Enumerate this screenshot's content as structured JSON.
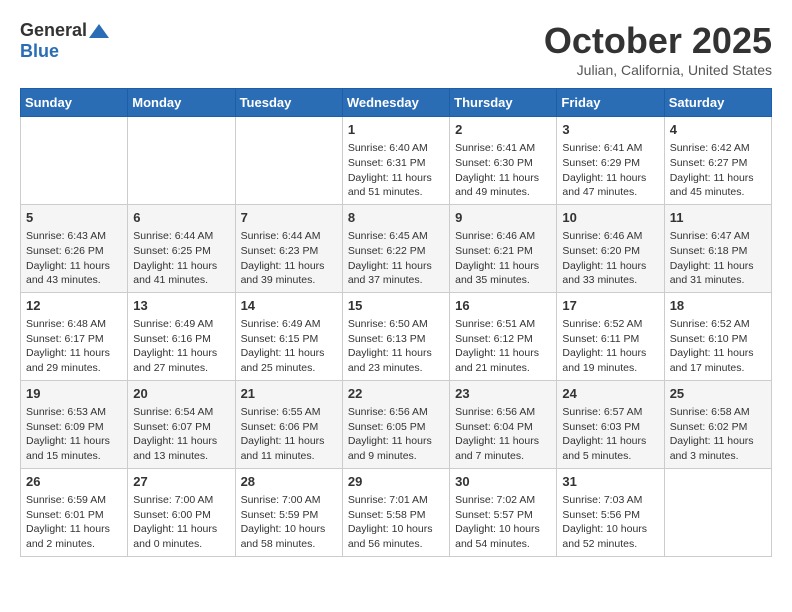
{
  "header": {
    "logo_general": "General",
    "logo_blue": "Blue",
    "month": "October 2025",
    "location": "Julian, California, United States"
  },
  "weekdays": [
    "Sunday",
    "Monday",
    "Tuesday",
    "Wednesday",
    "Thursday",
    "Friday",
    "Saturday"
  ],
  "weeks": [
    [
      {
        "day": "",
        "info": ""
      },
      {
        "day": "",
        "info": ""
      },
      {
        "day": "",
        "info": ""
      },
      {
        "day": "1",
        "info": "Sunrise: 6:40 AM\nSunset: 6:31 PM\nDaylight: 11 hours and 51 minutes."
      },
      {
        "day": "2",
        "info": "Sunrise: 6:41 AM\nSunset: 6:30 PM\nDaylight: 11 hours and 49 minutes."
      },
      {
        "day": "3",
        "info": "Sunrise: 6:41 AM\nSunset: 6:29 PM\nDaylight: 11 hours and 47 minutes."
      },
      {
        "day": "4",
        "info": "Sunrise: 6:42 AM\nSunset: 6:27 PM\nDaylight: 11 hours and 45 minutes."
      }
    ],
    [
      {
        "day": "5",
        "info": "Sunrise: 6:43 AM\nSunset: 6:26 PM\nDaylight: 11 hours and 43 minutes."
      },
      {
        "day": "6",
        "info": "Sunrise: 6:44 AM\nSunset: 6:25 PM\nDaylight: 11 hours and 41 minutes."
      },
      {
        "day": "7",
        "info": "Sunrise: 6:44 AM\nSunset: 6:23 PM\nDaylight: 11 hours and 39 minutes."
      },
      {
        "day": "8",
        "info": "Sunrise: 6:45 AM\nSunset: 6:22 PM\nDaylight: 11 hours and 37 minutes."
      },
      {
        "day": "9",
        "info": "Sunrise: 6:46 AM\nSunset: 6:21 PM\nDaylight: 11 hours and 35 minutes."
      },
      {
        "day": "10",
        "info": "Sunrise: 6:46 AM\nSunset: 6:20 PM\nDaylight: 11 hours and 33 minutes."
      },
      {
        "day": "11",
        "info": "Sunrise: 6:47 AM\nSunset: 6:18 PM\nDaylight: 11 hours and 31 minutes."
      }
    ],
    [
      {
        "day": "12",
        "info": "Sunrise: 6:48 AM\nSunset: 6:17 PM\nDaylight: 11 hours and 29 minutes."
      },
      {
        "day": "13",
        "info": "Sunrise: 6:49 AM\nSunset: 6:16 PM\nDaylight: 11 hours and 27 minutes."
      },
      {
        "day": "14",
        "info": "Sunrise: 6:49 AM\nSunset: 6:15 PM\nDaylight: 11 hours and 25 minutes."
      },
      {
        "day": "15",
        "info": "Sunrise: 6:50 AM\nSunset: 6:13 PM\nDaylight: 11 hours and 23 minutes."
      },
      {
        "day": "16",
        "info": "Sunrise: 6:51 AM\nSunset: 6:12 PM\nDaylight: 11 hours and 21 minutes."
      },
      {
        "day": "17",
        "info": "Sunrise: 6:52 AM\nSunset: 6:11 PM\nDaylight: 11 hours and 19 minutes."
      },
      {
        "day": "18",
        "info": "Sunrise: 6:52 AM\nSunset: 6:10 PM\nDaylight: 11 hours and 17 minutes."
      }
    ],
    [
      {
        "day": "19",
        "info": "Sunrise: 6:53 AM\nSunset: 6:09 PM\nDaylight: 11 hours and 15 minutes."
      },
      {
        "day": "20",
        "info": "Sunrise: 6:54 AM\nSunset: 6:07 PM\nDaylight: 11 hours and 13 minutes."
      },
      {
        "day": "21",
        "info": "Sunrise: 6:55 AM\nSunset: 6:06 PM\nDaylight: 11 hours and 11 minutes."
      },
      {
        "day": "22",
        "info": "Sunrise: 6:56 AM\nSunset: 6:05 PM\nDaylight: 11 hours and 9 minutes."
      },
      {
        "day": "23",
        "info": "Sunrise: 6:56 AM\nSunset: 6:04 PM\nDaylight: 11 hours and 7 minutes."
      },
      {
        "day": "24",
        "info": "Sunrise: 6:57 AM\nSunset: 6:03 PM\nDaylight: 11 hours and 5 minutes."
      },
      {
        "day": "25",
        "info": "Sunrise: 6:58 AM\nSunset: 6:02 PM\nDaylight: 11 hours and 3 minutes."
      }
    ],
    [
      {
        "day": "26",
        "info": "Sunrise: 6:59 AM\nSunset: 6:01 PM\nDaylight: 11 hours and 2 minutes."
      },
      {
        "day": "27",
        "info": "Sunrise: 7:00 AM\nSunset: 6:00 PM\nDaylight: 11 hours and 0 minutes."
      },
      {
        "day": "28",
        "info": "Sunrise: 7:00 AM\nSunset: 5:59 PM\nDaylight: 10 hours and 58 minutes."
      },
      {
        "day": "29",
        "info": "Sunrise: 7:01 AM\nSunset: 5:58 PM\nDaylight: 10 hours and 56 minutes."
      },
      {
        "day": "30",
        "info": "Sunrise: 7:02 AM\nSunset: 5:57 PM\nDaylight: 10 hours and 54 minutes."
      },
      {
        "day": "31",
        "info": "Sunrise: 7:03 AM\nSunset: 5:56 PM\nDaylight: 10 hours and 52 minutes."
      },
      {
        "day": "",
        "info": ""
      }
    ]
  ]
}
